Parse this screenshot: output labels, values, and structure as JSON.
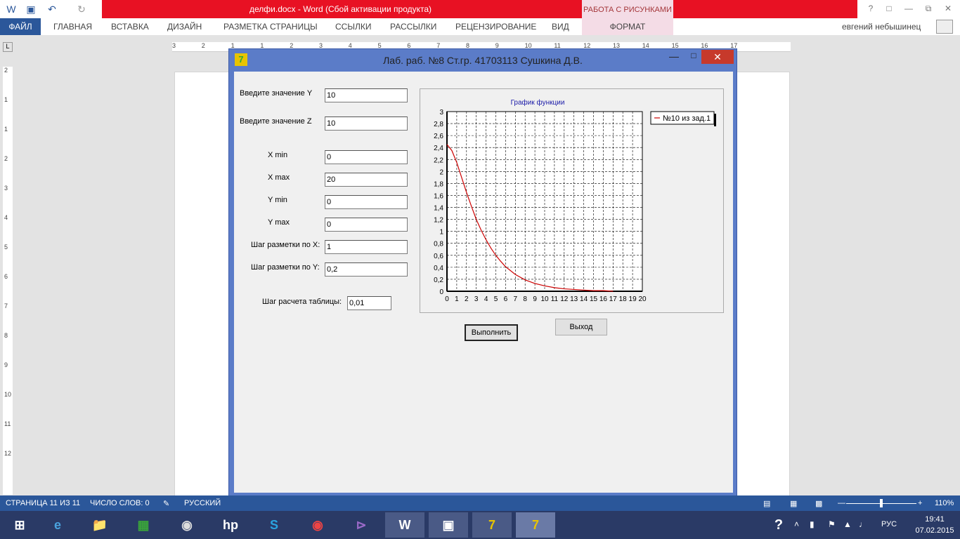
{
  "word": {
    "doc_title": "делфи.docx -  Word (Сбой активации продукта)",
    "picture_tools": "РАБОТА С РИСУНКАМИ",
    "tabs": [
      "ФАЙЛ",
      "ГЛАВНАЯ",
      "ВСТАВКА",
      "ДИЗАЙН",
      "РАЗМЕТКА СТРАНИЦЫ",
      "ССЫЛКИ",
      "РАССЫЛКИ",
      "РЕЦЕНЗИРОВАНИЕ",
      "ВИД"
    ],
    "tab_format": "ФОРМАТ",
    "user": "евгений небышинец",
    "ruler_h": [
      "3",
      "2",
      "1",
      "1",
      "2",
      "3",
      "4",
      "5",
      "6",
      "7",
      "8",
      "9",
      "10",
      "11",
      "12",
      "13",
      "14",
      "15",
      "16",
      "17"
    ],
    "ruler_v": [
      "2",
      "1",
      "1",
      "2",
      "3",
      "4",
      "5",
      "6",
      "7",
      "8",
      "9",
      "10",
      "11",
      "12"
    ]
  },
  "dialog": {
    "title": "Лаб. раб. №8 Ст.гр.  41703113 Сушкина Д.В.",
    "labels": {
      "y": "Введите значение Y",
      "z": "Введите значение Z",
      "xmin": "X min",
      "xmax": "X max",
      "ymin": "Y min",
      "ymax": "Y max",
      "stepx": "Шаг разметки по X:",
      "stepy": "Шаг разметки по Y:",
      "step_table": "Шаг расчета таблицы:"
    },
    "values": {
      "y": "10",
      "z": "10",
      "xmin": "0",
      "xmax": "20",
      "ymin": "0",
      "ymax": "0",
      "stepx": "1",
      "stepy": "0,2",
      "step_table": "0,01"
    },
    "buttons": {
      "run": "Выполнить",
      "exit": "Выход"
    }
  },
  "chart_data": {
    "type": "line",
    "title": "График функции",
    "xlabel": "",
    "ylabel": "",
    "xlim": [
      0,
      20
    ],
    "ylim": [
      0,
      3
    ],
    "x_ticks": [
      "0",
      "1",
      "2",
      "3",
      "4",
      "5",
      "6",
      "7",
      "8",
      "9",
      "10",
      "11",
      "12",
      "13",
      "14",
      "15",
      "16",
      "17",
      "18",
      "19",
      "20"
    ],
    "y_ticks": [
      "0",
      "0,2",
      "0,4",
      "0,6",
      "0,8",
      "1",
      "1,2",
      "1,4",
      "1,6",
      "1,8",
      "2",
      "2,2",
      "2,4",
      "2,6",
      "2,8",
      "3"
    ],
    "grid": true,
    "legend_position": "right",
    "series": [
      {
        "name": "№10 из зад.1",
        "color": "#cc0000",
        "x": [
          0,
          0.5,
          1,
          1.5,
          2,
          2.5,
          3,
          3.5,
          4,
          4.5,
          5,
          5.5,
          6,
          7,
          8,
          9,
          10,
          11,
          12,
          13,
          14,
          15,
          16,
          17
        ],
        "y": [
          2.45,
          2.35,
          2.15,
          1.9,
          1.65,
          1.42,
          1.2,
          1.02,
          0.86,
          0.72,
          0.6,
          0.5,
          0.41,
          0.28,
          0.19,
          0.13,
          0.09,
          0.06,
          0.04,
          0.03,
          0.02,
          0.01,
          0.01,
          0.0
        ]
      }
    ]
  },
  "statusbar": {
    "page": "СТРАНИЦА 11 ИЗ 11",
    "words": "ЧИСЛО СЛОВ: 0",
    "lang": "РУССКИЙ",
    "zoom": "110%"
  },
  "taskbar": {
    "lang": "РУС",
    "time": "19:41",
    "date": "07.02.2015"
  }
}
